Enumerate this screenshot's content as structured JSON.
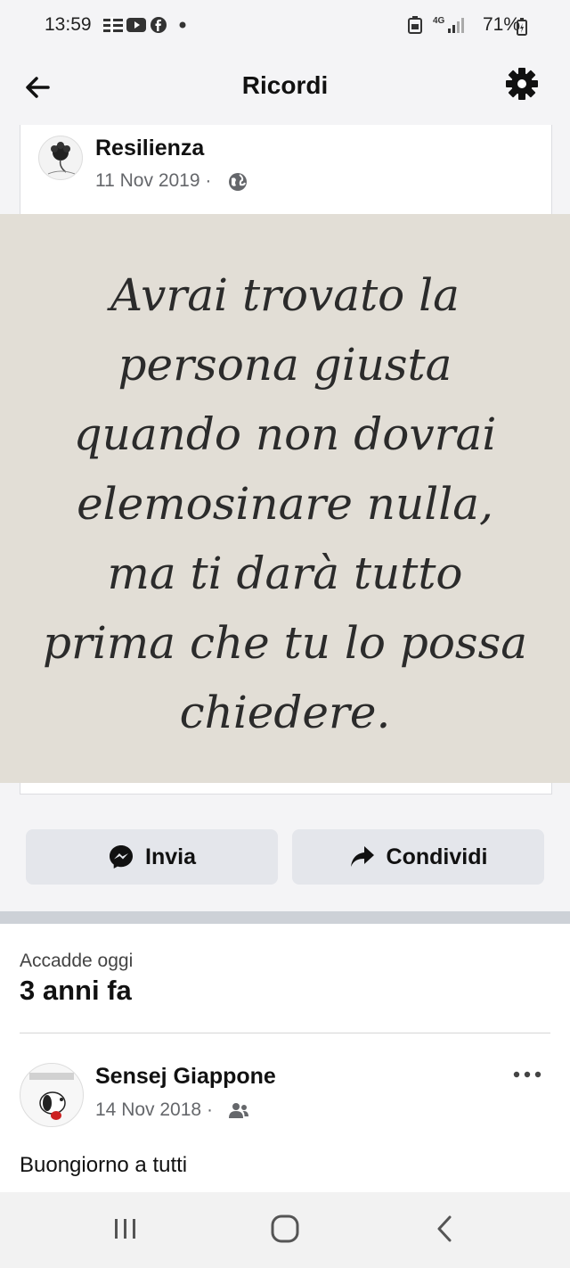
{
  "status_bar": {
    "time": "13:59",
    "signal": "4G",
    "battery": "71%"
  },
  "header": {
    "title": "Ricordi"
  },
  "post1": {
    "author": "Resilienza",
    "date": "11 Nov 2019",
    "separator": "·",
    "image_quote": [
      "Avrai trovato la",
      "persona giusta",
      "quando non dovrai",
      "elemosinare nulla,",
      "ma ti darà tutto",
      "prima che tu lo possa",
      "chiedere."
    ]
  },
  "actions": {
    "send": "Invia",
    "share": "Condividi"
  },
  "memory": {
    "label": "Accadde oggi",
    "years_ago": "3 anni fa"
  },
  "post2": {
    "author": "Sensej Giappone",
    "date": "14 Nov 2018",
    "separator": "·",
    "text": "Buongiorno a tutti"
  },
  "colors": {
    "button_bg": "#e4e6eb",
    "secondary_text": "#65676b",
    "photo_bg": "#e2ded6"
  }
}
